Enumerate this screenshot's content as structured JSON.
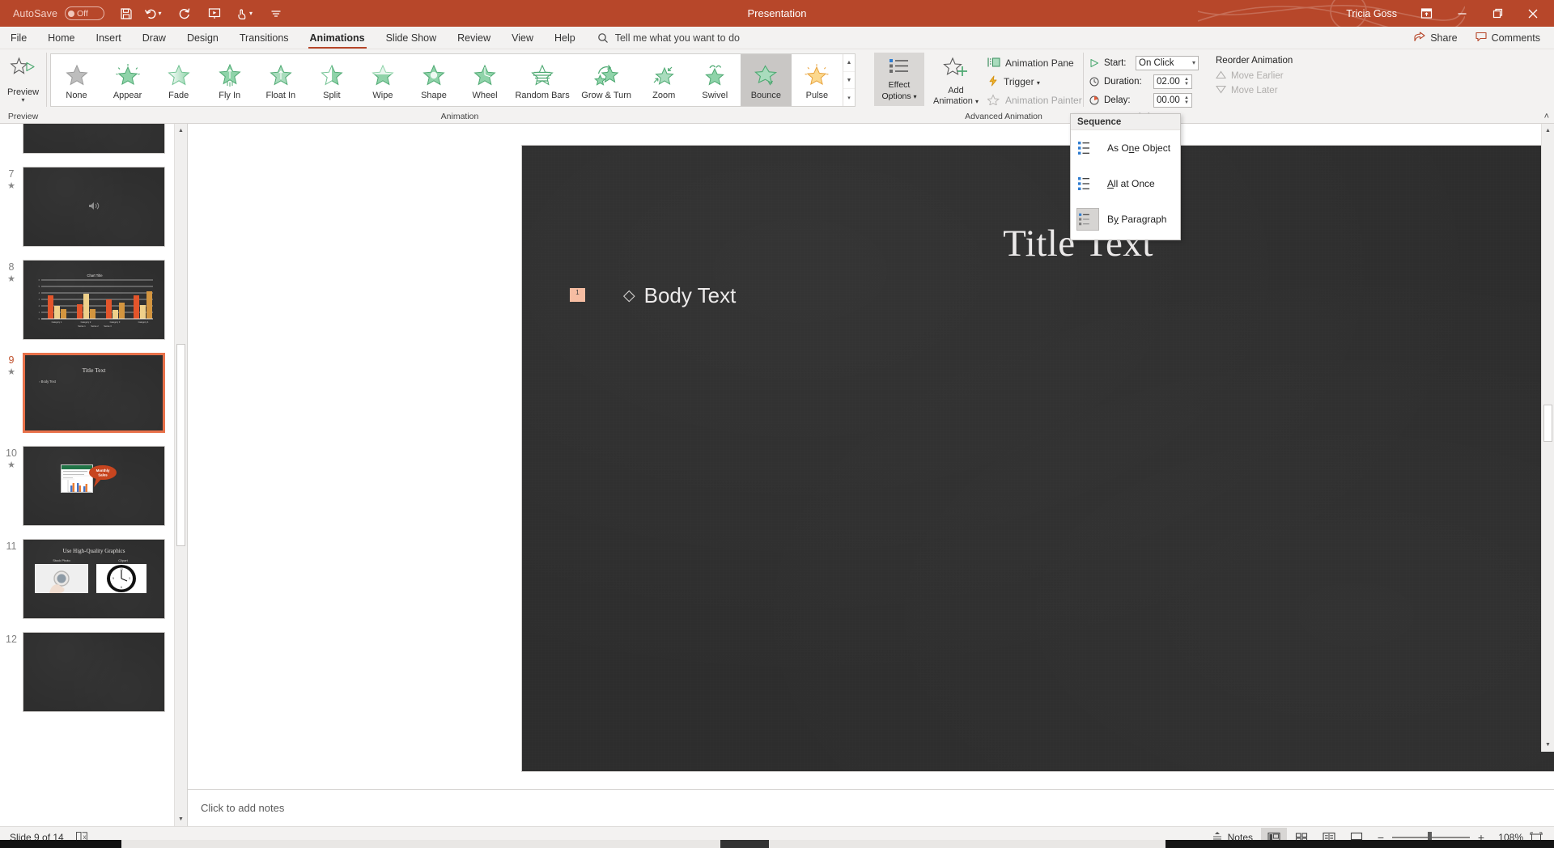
{
  "titlebar": {
    "autosave_label": "AutoSave",
    "autosave_state": "Off",
    "title": "Presentation",
    "user": "Tricia Goss",
    "icons": [
      "save-icon",
      "undo-icon",
      "redo-icon",
      "start-slideshow-icon",
      "touch-mode-icon",
      "customize-qat-icon"
    ],
    "window_buttons": [
      "ribbon-display-options",
      "minimize",
      "restore",
      "close"
    ]
  },
  "tabs": {
    "items": [
      {
        "label": "File",
        "active": false
      },
      {
        "label": "Home",
        "active": false
      },
      {
        "label": "Insert",
        "active": false
      },
      {
        "label": "Draw",
        "active": false
      },
      {
        "label": "Design",
        "active": false
      },
      {
        "label": "Transitions",
        "active": false
      },
      {
        "label": "Animations",
        "active": true
      },
      {
        "label": "Slide Show",
        "active": false
      },
      {
        "label": "Review",
        "active": false
      },
      {
        "label": "View",
        "active": false
      },
      {
        "label": "Help",
        "active": false
      }
    ],
    "tellme_placeholder": "Tell me what you want to do",
    "share_label": "Share",
    "comments_label": "Comments"
  },
  "ribbon": {
    "preview": {
      "label": "Preview",
      "group_label": "Preview"
    },
    "animation": {
      "group_label": "Animation",
      "items": [
        {
          "label": "None",
          "style": "none",
          "selected": false
        },
        {
          "label": "Appear",
          "style": "appear",
          "selected": false
        },
        {
          "label": "Fade",
          "style": "fade",
          "selected": false
        },
        {
          "label": "Fly In",
          "style": "flyin",
          "selected": false
        },
        {
          "label": "Float In",
          "style": "floatin",
          "selected": false
        },
        {
          "label": "Split",
          "style": "split",
          "selected": false
        },
        {
          "label": "Wipe",
          "style": "wipe",
          "selected": false
        },
        {
          "label": "Shape",
          "style": "shape",
          "selected": false
        },
        {
          "label": "Wheel",
          "style": "wheel",
          "selected": false
        },
        {
          "label": "Random Bars",
          "style": "randombars",
          "selected": false
        },
        {
          "label": "Grow & Turn",
          "style": "growturn",
          "selected": false
        },
        {
          "label": "Zoom",
          "style": "zoom",
          "selected": false
        },
        {
          "label": "Swivel",
          "style": "swivel",
          "selected": false
        },
        {
          "label": "Bounce",
          "style": "bounce",
          "selected": true
        },
        {
          "label": "Pulse",
          "style": "pulse",
          "selected": false
        }
      ]
    },
    "effect_options": {
      "label_line1": "Effect",
      "label_line2": "Options",
      "pressed": true
    },
    "advanced": {
      "group_label": "Advanced Animation",
      "add_animation_line1": "Add",
      "add_animation_line2": "Animation",
      "animation_pane": "Animation Pane",
      "trigger": "Trigger",
      "animation_painter": "Animation Painter"
    },
    "timing": {
      "group_label": "Timing",
      "start_label": "Start:",
      "start_value": "On Click",
      "duration_label": "Duration:",
      "duration_value": "02.00",
      "delay_label": "Delay:",
      "delay_value": "00.00"
    },
    "reorder": {
      "title": "Reorder Animation",
      "move_earlier": "Move Earlier",
      "move_later": "Move Later"
    },
    "collapse_label": "collapse-ribbon"
  },
  "dropdown": {
    "header": "Sequence",
    "items": [
      {
        "label_pre": "As O",
        "accel": "n",
        "label_post": "e Object",
        "selected": false
      },
      {
        "label_pre": "",
        "accel": "A",
        "label_post": "ll at Once",
        "selected": false
      },
      {
        "label_pre": "B",
        "accel": "y",
        "label_post": " Paragraph",
        "selected": true
      }
    ]
  },
  "thumbnails": [
    {
      "number": "",
      "animated": false,
      "selected": false,
      "type": "image-cones",
      "title": "",
      "body": ""
    },
    {
      "number": "7",
      "animated": true,
      "selected": false,
      "type": "audio",
      "title": "",
      "body": ""
    },
    {
      "number": "8",
      "animated": true,
      "selected": false,
      "type": "chart",
      "title": "Chart Title",
      "body": ""
    },
    {
      "number": "9",
      "animated": true,
      "selected": true,
      "type": "title-body",
      "title": "Title Text",
      "body": "Body Text"
    },
    {
      "number": "10",
      "animated": true,
      "selected": false,
      "type": "excel-callout",
      "title": "",
      "body": "Monthly Sales"
    },
    {
      "number": "11",
      "animated": false,
      "selected": false,
      "type": "graphics",
      "title": "Use High-Quality Graphics",
      "body": ""
    },
    {
      "number": "12",
      "animated": false,
      "selected": false,
      "type": "blank",
      "title": "",
      "body": ""
    }
  ],
  "slide": {
    "title": "Title Text",
    "body": "Body Text",
    "bullet": "◇",
    "animation_tag": "1"
  },
  "notes": {
    "placeholder": "Click to add notes"
  },
  "statusbar": {
    "slide_indicator": "Slide 9 of 14",
    "accessibility_icon": "accessibility-checker-icon",
    "notes_label": "Notes",
    "views": [
      "normal-view",
      "slide-sorter-view",
      "reading-view",
      "slide-show-view"
    ],
    "zoom_percent": "108%",
    "zoom_minus": "−",
    "zoom_plus": "+",
    "fit_label": "fit-slide-to-window"
  },
  "colors": {
    "accent": "#b7472a",
    "selection": "#e8714a",
    "green_star": "#4ea972",
    "orange_star": "#e8a33d",
    "tag_bg": "#f6bda2"
  }
}
